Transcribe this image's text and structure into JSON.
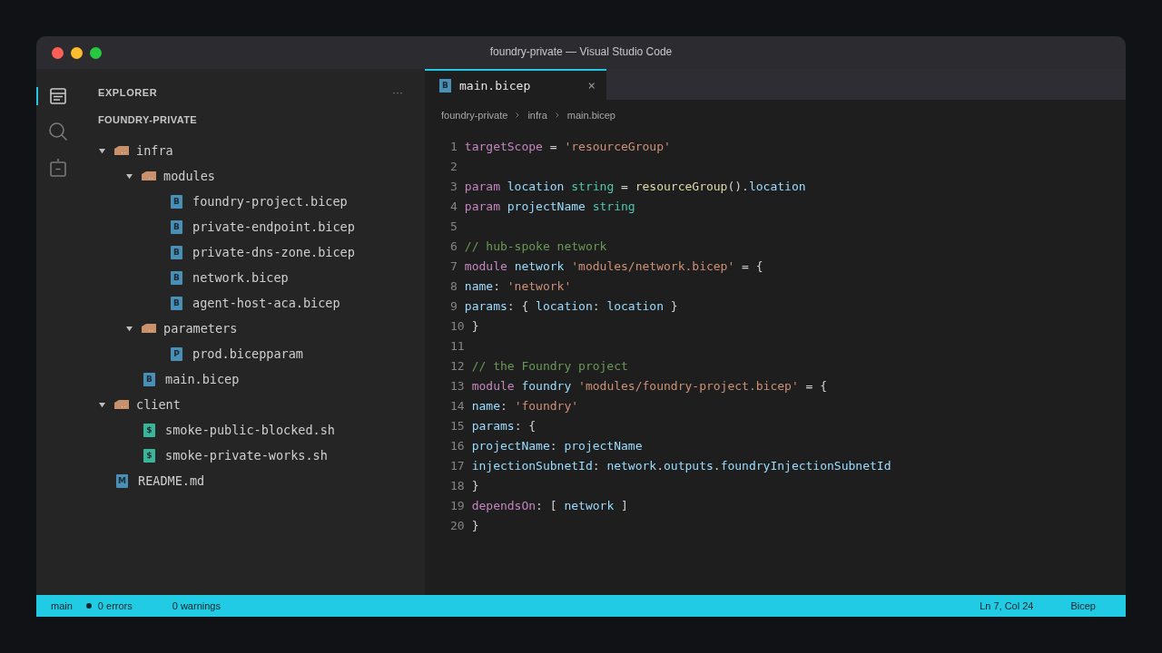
{
  "window": {
    "title": "foundry-private — Visual Studio Code"
  },
  "activity_bar": [
    {
      "kind": "explorer",
      "selected": true
    },
    {
      "kind": "search",
      "selected": false
    },
    {
      "kind": "box",
      "selected": false
    }
  ],
  "sidebar": {
    "title": "EXPLORER",
    "more": "···",
    "root": "FOUNDRY-PRIVATE",
    "tree": [
      {
        "kind": "folder",
        "label": "infra",
        "expanded": true,
        "children": [
          {
            "kind": "folder",
            "label": "modules",
            "expanded": true,
            "children": [
              {
                "kind": "file",
                "badge": "B",
                "label": "foundry-project.bicep",
                "color": "#4a8fb5"
              },
              {
                "kind": "file",
                "badge": "B",
                "label": "private-endpoint.bicep",
                "color": "#4a8fb5"
              },
              {
                "kind": "file",
                "badge": "B",
                "label": "private-dns-zone.bicep",
                "color": "#4a8fb5"
              },
              {
                "kind": "file",
                "badge": "B",
                "label": "network.bicep",
                "color": "#4a8fb5"
              },
              {
                "kind": "file",
                "badge": "B",
                "label": "agent-host-aca.bicep",
                "color": "#4a8fb5"
              }
            ]
          },
          {
            "kind": "folder",
            "label": "parameters",
            "expanded": true,
            "children": [
              {
                "kind": "file",
                "badge": "P",
                "label": "prod.bicepparam",
                "color": "#4a8fb5"
              }
            ]
          },
          {
            "kind": "file",
            "badge": "B",
            "label": "main.bicep",
            "color": "#4a8fb5"
          }
        ]
      },
      {
        "kind": "folder",
        "label": "client",
        "expanded": true,
        "children": [
          {
            "kind": "file",
            "badge": "$",
            "label": "smoke-public-blocked.sh",
            "color": "#3bb59a"
          },
          {
            "kind": "file",
            "badge": "$",
            "label": "smoke-private-works.sh",
            "color": "#3bb59a"
          }
        ]
      },
      {
        "kind": "file",
        "badge": "M",
        "label": "README.md",
        "color": "#4a8fb5"
      }
    ]
  },
  "tabs": [
    {
      "badge": "B",
      "label": "main.bicep",
      "close": "×",
      "selected": true
    }
  ],
  "breadcrumbs": [
    "foundry-private",
    "infra",
    "main.bicep"
  ],
  "code": [
    {
      "number": "1",
      "tokens": [
        {
          "kind": "keyword",
          "text": "targetScope"
        },
        {
          "kind": "plain",
          "text": " = "
        },
        {
          "kind": "string",
          "text": "'resourceGroup'"
        }
      ]
    },
    {
      "number": "2"
    },
    {
      "number": "3",
      "tokens": [
        {
          "kind": "keyword",
          "text": "param "
        },
        {
          "kind": "var",
          "text": "location "
        },
        {
          "kind": "type",
          "text": "string"
        },
        {
          "kind": "plain",
          "text": " = "
        },
        {
          "kind": "func",
          "text": "resourceGroup"
        },
        {
          "kind": "plain",
          "text": "()."
        },
        {
          "kind": "var",
          "text": "location"
        }
      ]
    },
    {
      "number": "4",
      "tokens": [
        {
          "kind": "keyword",
          "text": "param "
        },
        {
          "kind": "var",
          "text": "projectName "
        },
        {
          "kind": "type",
          "text": "string"
        }
      ]
    },
    {
      "number": "5"
    },
    {
      "number": "6",
      "tokens": [
        {
          "kind": "comment",
          "text": "// hub-spoke network"
        }
      ]
    },
    {
      "number": "7",
      "tokens": [
        {
          "kind": "keyword",
          "text": "module "
        },
        {
          "kind": "var",
          "text": "network "
        },
        {
          "kind": "string",
          "text": "'modules/network.bicep'"
        },
        {
          "kind": "plain",
          "text": " = {"
        }
      ]
    },
    {
      "number": "8",
      "tokens": [
        {
          "kind": "var",
          "text": "name"
        },
        {
          "kind": "plain",
          "text": ": "
        },
        {
          "kind": "string",
          "text": "'network'"
        }
      ]
    },
    {
      "number": "9",
      "tokens": [
        {
          "kind": "var",
          "text": "params"
        },
        {
          "kind": "plain",
          "text": ": { "
        },
        {
          "kind": "var",
          "text": "location"
        },
        {
          "kind": "plain",
          "text": ": "
        },
        {
          "kind": "var",
          "text": "location"
        },
        {
          "kind": "plain",
          "text": " }"
        }
      ]
    },
    {
      "number": "10",
      "tokens": [
        {
          "kind": "plain",
          "text": "}"
        }
      ]
    },
    {
      "number": "11"
    },
    {
      "number": "12",
      "tokens": [
        {
          "kind": "comment",
          "text": "// the Foundry project"
        }
      ]
    },
    {
      "number": "13",
      "tokens": [
        {
          "kind": "keyword",
          "text": "module "
        },
        {
          "kind": "var",
          "text": "foundry "
        },
        {
          "kind": "string",
          "text": "'modules/foundry-project.bicep'"
        },
        {
          "kind": "plain",
          "text": " = {"
        }
      ]
    },
    {
      "number": "14",
      "tokens": [
        {
          "kind": "var",
          "text": "name"
        },
        {
          "kind": "plain",
          "text": ": "
        },
        {
          "kind": "string",
          "text": "'foundry'"
        }
      ]
    },
    {
      "number": "15",
      "tokens": [
        {
          "kind": "var",
          "text": "params"
        },
        {
          "kind": "plain",
          "text": ": {"
        }
      ]
    },
    {
      "number": "16",
      "tokens": [
        {
          "kind": "var",
          "text": "projectName"
        },
        {
          "kind": "plain",
          "text": ": "
        },
        {
          "kind": "var",
          "text": "projectName"
        }
      ]
    },
    {
      "number": "17",
      "tokens": [
        {
          "kind": "var",
          "text": "injectionSubnetId"
        },
        {
          "kind": "plain",
          "text": ": "
        },
        {
          "kind": "var",
          "text": "network"
        },
        {
          "kind": "plain",
          "text": "."
        },
        {
          "kind": "var",
          "text": "outputs"
        },
        {
          "kind": "plain",
          "text": "."
        },
        {
          "kind": "var",
          "text": "foundryInjectionSubnetId"
        }
      ]
    },
    {
      "number": "18",
      "tokens": [
        {
          "kind": "plain",
          "text": "}"
        }
      ]
    },
    {
      "number": "19",
      "tokens": [
        {
          "kind": "keyword",
          "text": "dependsOn"
        },
        {
          "kind": "plain",
          "text": ": [ "
        },
        {
          "kind": "var",
          "text": "network"
        },
        {
          "kind": "plain",
          "text": " ]"
        }
      ]
    },
    {
      "number": "20",
      "tokens": [
        {
          "kind": "plain",
          "text": "}"
        }
      ]
    }
  ],
  "status_bar": {
    "branch": "main",
    "errors": "0 errors",
    "warnings": "0 warnings",
    "position": "Ln 7, Col 24",
    "language": "Bicep"
  }
}
